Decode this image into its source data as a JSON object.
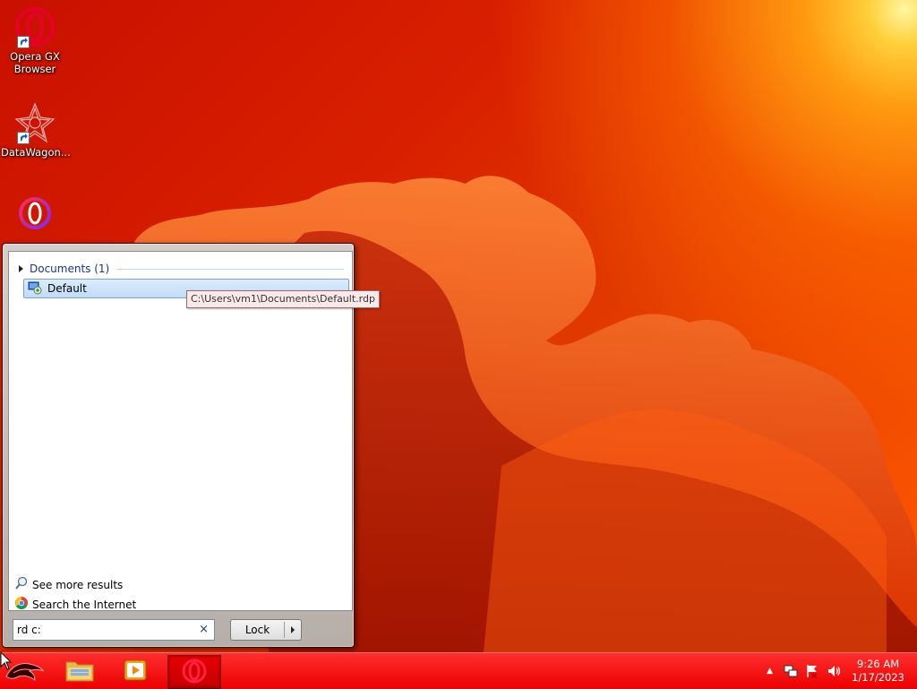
{
  "desktop": {
    "icons": [
      {
        "label": "Opera GX Browser",
        "icon": "opera-gx-icon"
      },
      {
        "label": "DataWagon...",
        "icon": "datawagon-icon"
      },
      {
        "label": "",
        "icon": "opera-icon"
      }
    ]
  },
  "start_menu": {
    "group_header": "Documents (1)",
    "results": [
      {
        "label": "Default",
        "icon": "remote-desktop-icon",
        "tooltip": "C:\\Users\\vm1\\Documents\\Default.rdp"
      }
    ],
    "see_more": "See more results",
    "search_internet": "Search the Internet",
    "search": {
      "value": "rd c:",
      "clear_symbol": "×"
    },
    "power_button": {
      "label": "Lock"
    }
  },
  "taskbar": {
    "start_button": {
      "icon": "rog-logo-icon"
    },
    "pinned": [
      {
        "name": "File Explorer",
        "icon": "folder-icon"
      },
      {
        "name": "Windows Media Player",
        "icon": "media-player-icon"
      },
      {
        "name": "Opera",
        "icon": "opera-icon",
        "active": true
      }
    ],
    "tray": {
      "show_hidden_symbol": "▲",
      "icons": [
        "network-icon",
        "action-center-icon",
        "volume-icon"
      ]
    },
    "clock": {
      "time": "9:26 AM",
      "date": "1/17/2023"
    }
  },
  "colors": {
    "taskbar": "#ff1a1a",
    "desktop": "#d82000",
    "selection": "#c1dcf8",
    "tooltip_bg": "#fbe8e8"
  }
}
